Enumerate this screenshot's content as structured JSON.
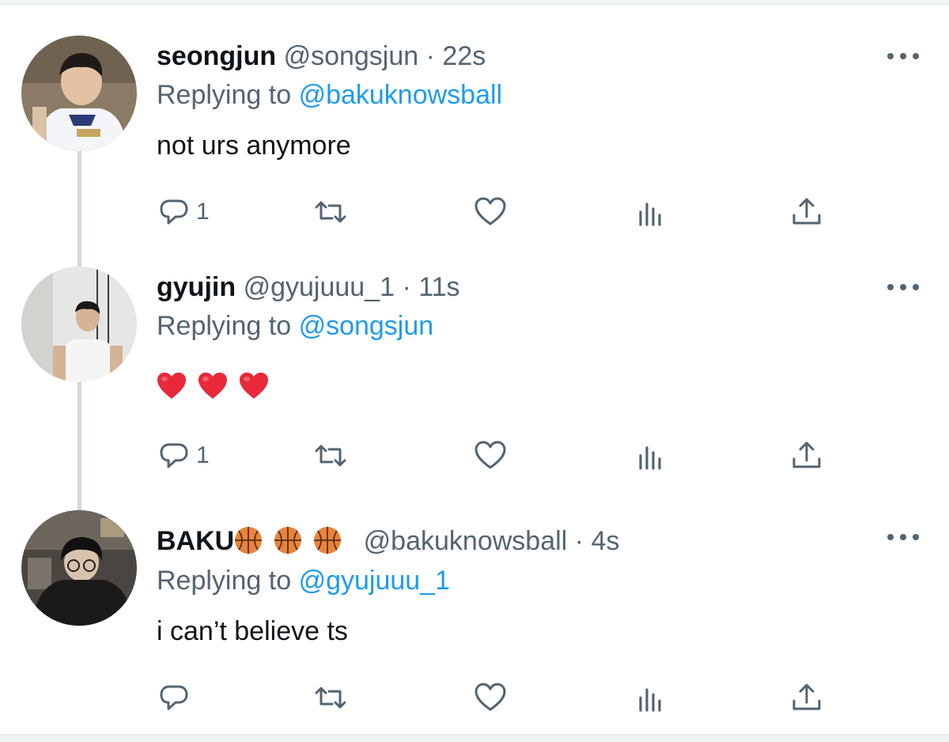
{
  "tweets": [
    {
      "name": "seongjun",
      "handle": "@songsjun",
      "separator": "·",
      "time": "22s",
      "replying_prefix": "Replying to",
      "replying_to": "@bakuknowsball",
      "text": "not urs anymore",
      "reply_count": "1",
      "actions": [
        "reply-icon",
        "retweet-icon",
        "like-icon",
        "analytics-icon",
        "share-icon"
      ]
    },
    {
      "name": "gyujin",
      "handle": "@gyujuuu_1",
      "separator": "·",
      "time": "11s",
      "replying_prefix": "Replying to",
      "replying_to": "@songsjun",
      "text": "❤️ ❤️ ❤️",
      "reply_count": "1",
      "actions": [
        "reply-icon",
        "retweet-icon",
        "like-icon",
        "analytics-icon",
        "share-icon"
      ]
    },
    {
      "name": "BAKU",
      "name_emoji": "🏀 🏀 🏀",
      "handle": "@bakuknowsball",
      "separator": "·",
      "time": "4s",
      "replying_prefix": "Replying to",
      "replying_to": "@gyujuuu_1",
      "text": "i can’t believe ts",
      "reply_count": "",
      "actions": [
        "reply-icon",
        "retweet-icon",
        "like-icon",
        "analytics-icon",
        "share-icon"
      ]
    }
  ],
  "colors": {
    "text": "#0f1419",
    "secondary": "#536471",
    "link": "#1d9bf0",
    "thread_line": "#cfd9de",
    "heart": "#e8293a",
    "basketball": "#e8843c"
  }
}
